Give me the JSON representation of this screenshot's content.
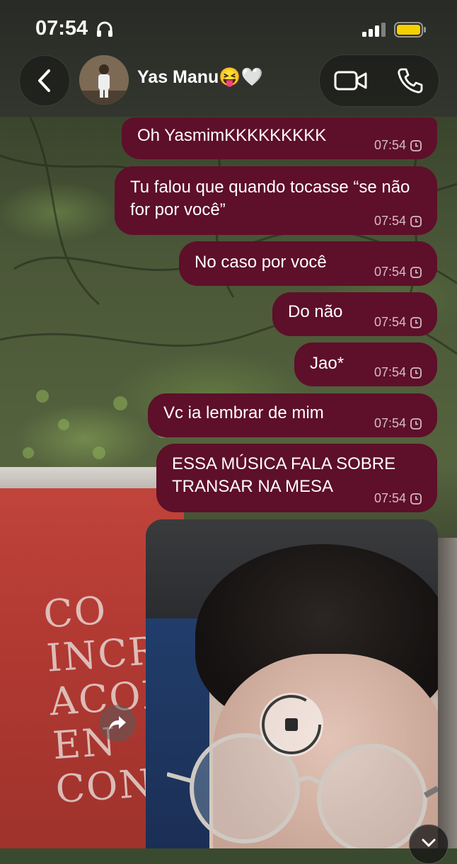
{
  "status_bar": {
    "time": "07:54"
  },
  "header": {
    "contact_name": "Yas Manu😝🤍"
  },
  "messages": [
    {
      "text": "Oh YasmimKKKKKKKKK",
      "time": "07:54"
    },
    {
      "text": "Tu falou que quando tocasse “se não for por você”",
      "time": "07:54"
    },
    {
      "text": "No caso por você",
      "time": "07:54"
    },
    {
      "text": "Do não",
      "time": "07:54"
    },
    {
      "text": "Jao*",
      "time": "07:54"
    },
    {
      "text": "Vc ia lembrar de mim",
      "time": "07:54"
    },
    {
      "text": "ESSA MÚSICA FALA SOBRE TRANSAR NA MESA",
      "time": "07:54"
    }
  ],
  "wallpaper": {
    "sign_text": "CO\nINCR\nACONT\nEN\nCON"
  },
  "colors": {
    "bubble": "#5e0f2a",
    "header": "#2c2e2a"
  }
}
